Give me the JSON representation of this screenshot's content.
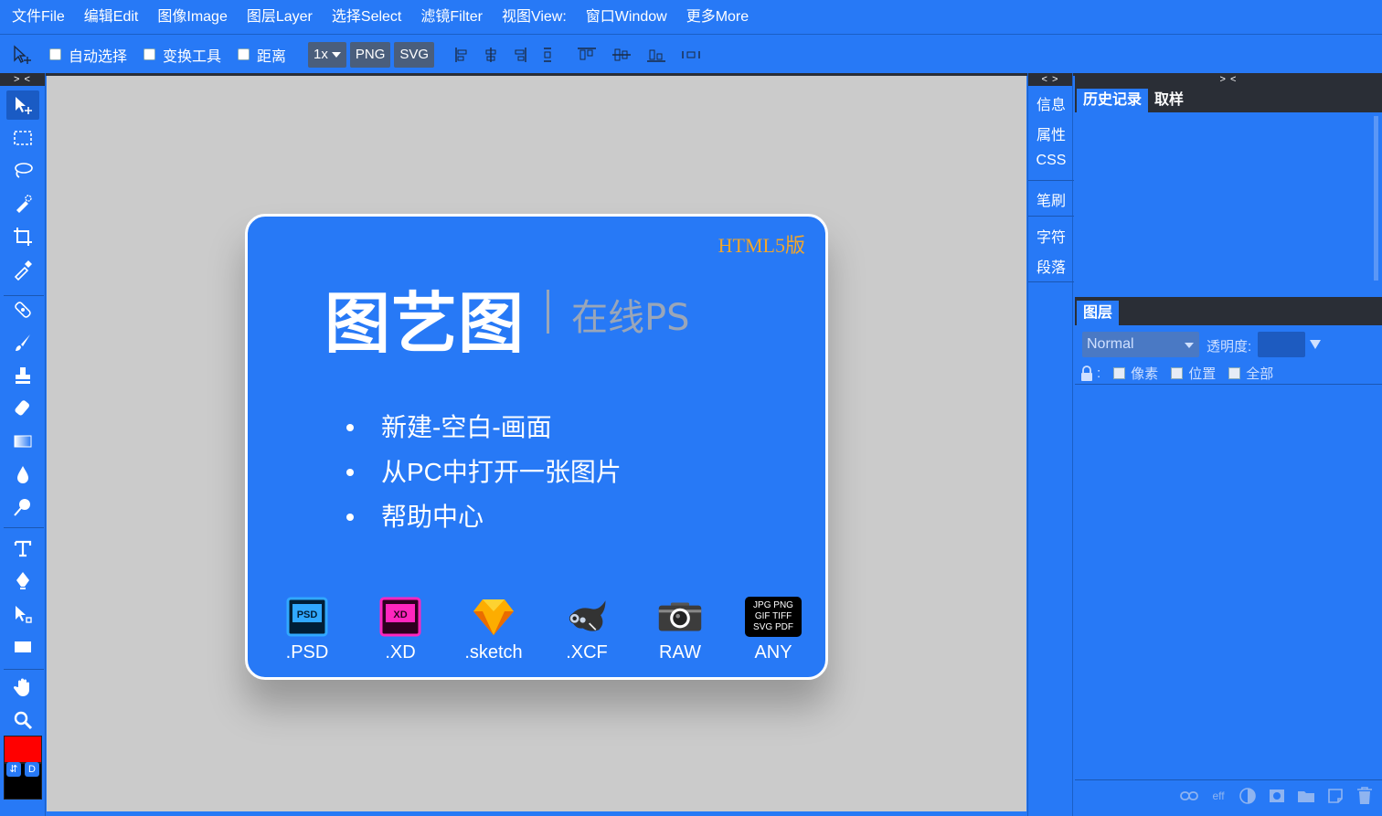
{
  "menubar": {
    "items": [
      "文件File",
      "编辑Edit",
      "图像Image",
      "图层Layer",
      "选择Select",
      "滤镜Filter",
      "视图View:",
      "窗口Window",
      "更多More"
    ]
  },
  "options": {
    "auto_select": "自动选择",
    "transform_tools": "变换工具",
    "distance": "距离",
    "zoom": "1x",
    "png": "PNG",
    "svg": "SVG"
  },
  "toolbar": {
    "collapse": "> <"
  },
  "color": {
    "foreground": "#ff0000",
    "background": "#000000",
    "swap": "⇵",
    "default": "D"
  },
  "card": {
    "badge": "HTML5版",
    "title": "图艺图",
    "subtitle": "在线PS",
    "links": [
      "新建-空白-画面",
      "从PC中打开一张图片",
      "帮助中心"
    ],
    "formats": [
      ".PSD",
      ".XD",
      ".sketch",
      ".XCF",
      "RAW",
      "ANY"
    ],
    "psd_icon": "PSD",
    "xd_icon": "XD",
    "any_icon_text": [
      "JPG PNG",
      "GIF TIFF",
      "SVG PDF"
    ]
  },
  "midpanel": {
    "collapse": "< >",
    "items": [
      "信息",
      "属性",
      "CSS",
      "笔刷",
      "字符",
      "段落"
    ]
  },
  "rightpanel": {
    "collapse": "> <",
    "tabs": [
      "历史记录",
      "取样"
    ],
    "layers_tab": "图层",
    "blend_mode": "Normal",
    "opacity_label": "透明度:",
    "lock_colon": ":",
    "lock_options": [
      "像素",
      "位置",
      "全部"
    ],
    "footer_eff": "eff"
  },
  "colors": {
    "accent": "#2779f6",
    "dark": "#2a2e36",
    "canvas": "#cbcbcb",
    "badge": "#f2a62b"
  }
}
